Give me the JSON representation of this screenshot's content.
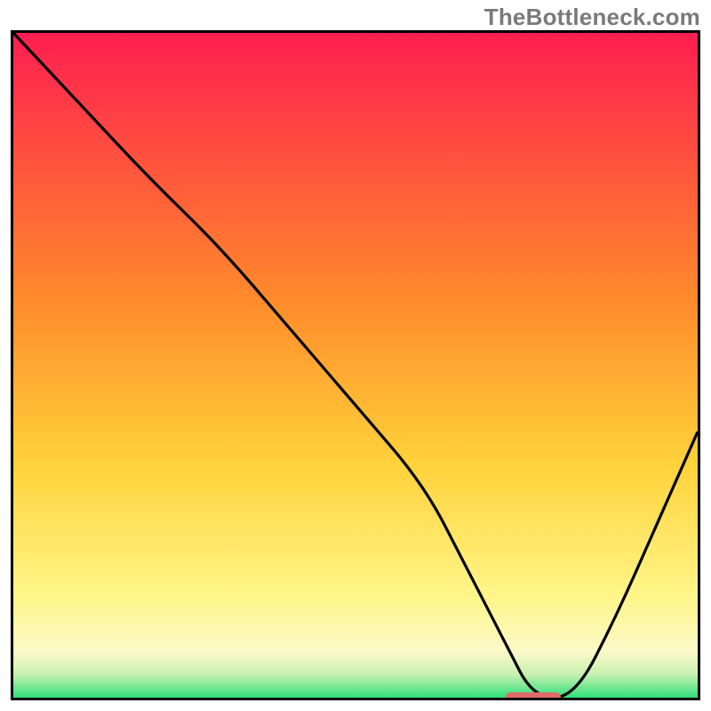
{
  "watermark": "TheBottleneck.com",
  "chart_data": {
    "type": "line",
    "title": "",
    "xlabel": "",
    "ylabel": "",
    "xlim": [
      0,
      100
    ],
    "ylim": [
      0,
      100
    ],
    "gradient_stops": [
      {
        "offset": 0.0,
        "color": "#ff1e50"
      },
      {
        "offset": 0.4,
        "color": "#ff8a2b"
      },
      {
        "offset": 0.65,
        "color": "#ffd23a"
      },
      {
        "offset": 0.85,
        "color": "#fff68a"
      },
      {
        "offset": 0.93,
        "color": "#fbf9c8"
      },
      {
        "offset": 0.965,
        "color": "#c7f0b0"
      },
      {
        "offset": 1.0,
        "color": "#2fe07a"
      }
    ],
    "series": [
      {
        "name": "bottleneck-curve",
        "x": [
          0,
          10,
          20,
          30,
          40,
          50,
          60,
          66,
          72,
          76,
          82,
          88,
          94,
          100
        ],
        "y": [
          100,
          89,
          78,
          68,
          56,
          44,
          32,
          20,
          8,
          0,
          0,
          12,
          26,
          40
        ]
      }
    ],
    "marker": {
      "name": "optimal-range",
      "x_start": 72,
      "x_end": 80,
      "y": 0,
      "color": "#e06a6a"
    }
  }
}
